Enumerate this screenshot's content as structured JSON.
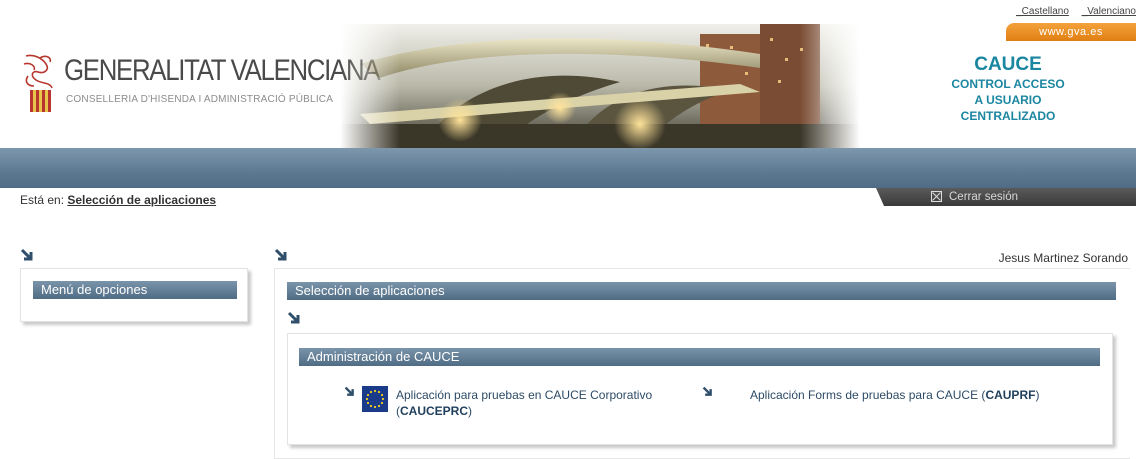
{
  "lang": {
    "castellano": "_Castellano",
    "valenciano": "_Valenciano"
  },
  "gva_link": "www.gva.es",
  "logo": {
    "name": "GENERALITAT VALENCIANA",
    "sub": "CONSELLERIA D'HISENDA I ADMINISTRACIÓ PÚBLICA"
  },
  "cauce": {
    "title": "CAUCE",
    "line1": "CONTROL ACCESO",
    "line2": "A USUARIO",
    "line3": "CENTRALIZADO"
  },
  "breadcrumb": {
    "prefix": "Está en:",
    "current": "Selección de aplicaciones"
  },
  "logout": "Cerrar sesión",
  "user": "Jesus Martinez Sorando",
  "menu": {
    "title": "Menú de opciones"
  },
  "main": {
    "title": "Selección de aplicaciones",
    "group": {
      "title": "Administración de CAUCE",
      "apps": [
        {
          "label": "Aplicación para pruebas en CAUCE Corporativo",
          "open": "(",
          "code": "CAUCEPRC",
          "close": ")",
          "icon": "eu-flag-icon"
        },
        {
          "label": "Aplicación Forms de pruebas para CAUCE (",
          "code": "CAUPRF",
          "close": ")"
        }
      ]
    }
  },
  "colors": {
    "band": "#5c7991",
    "accent": "#1a86a0",
    "orange": "#e07f12"
  }
}
